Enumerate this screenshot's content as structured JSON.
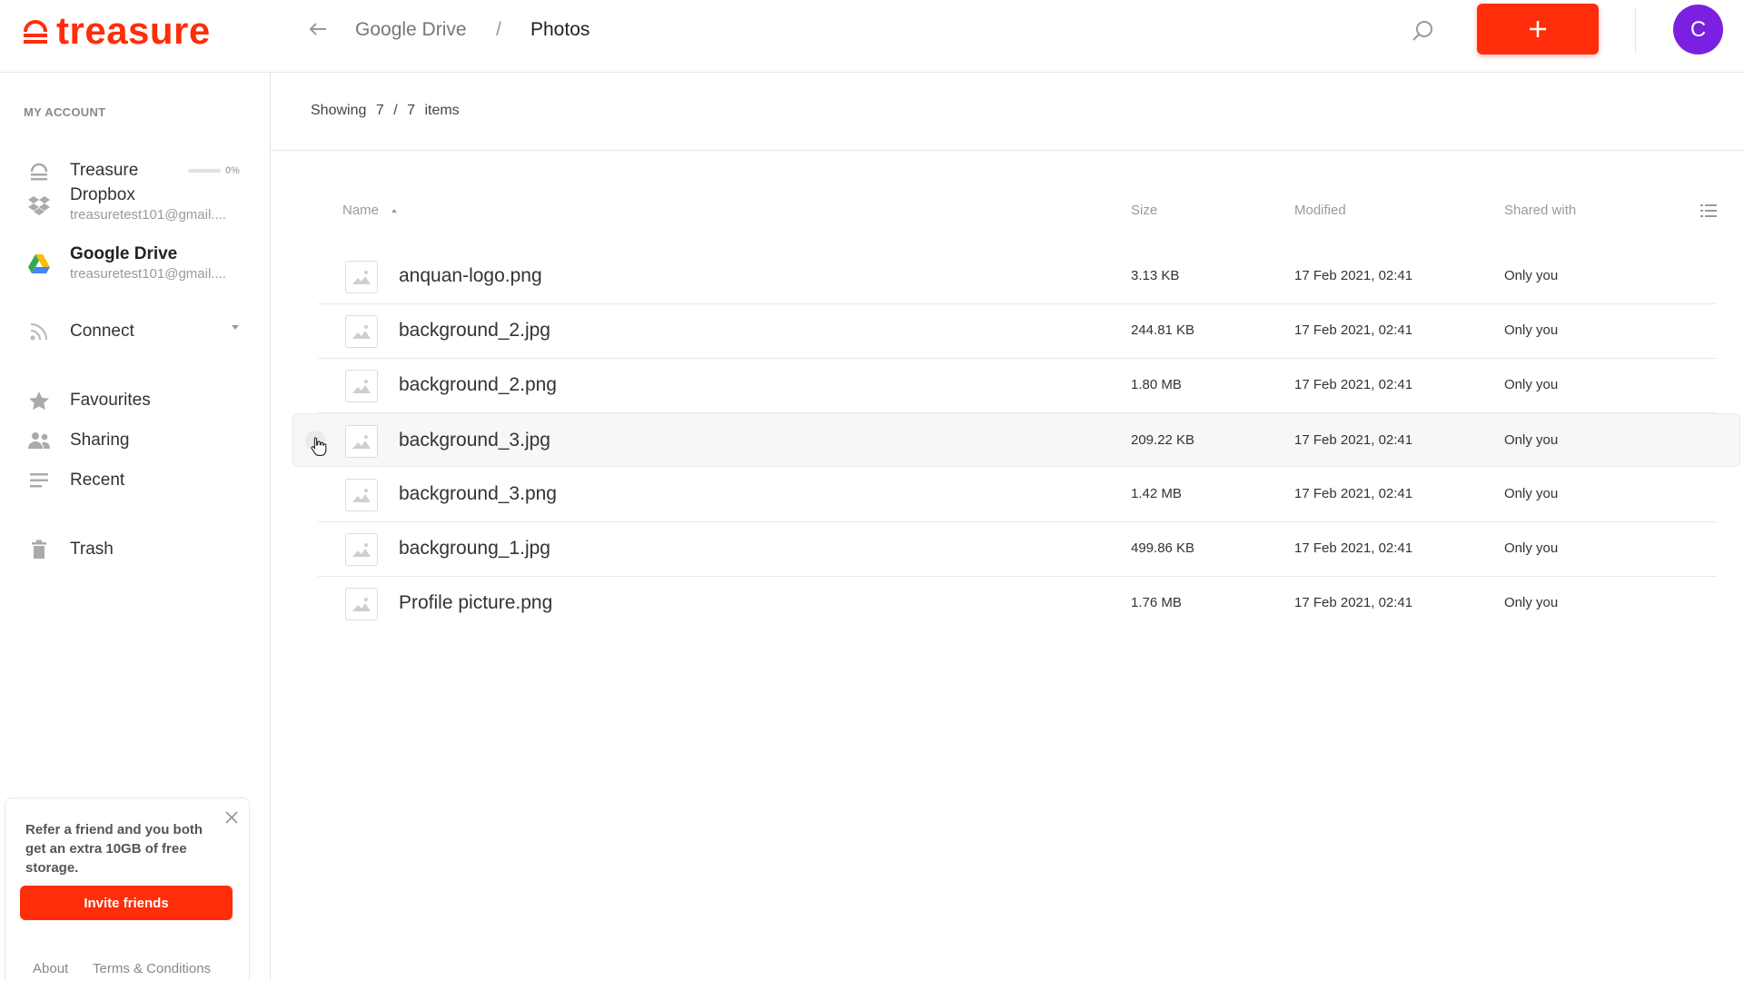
{
  "header": {
    "logo_text": "treasure",
    "breadcrumb": {
      "parent": "Google Drive",
      "separator": "/",
      "current": "Photos"
    },
    "add_label": "+",
    "avatar_initial": "C",
    "accent_color": "#ff2d0a",
    "avatar_color": "#7b1fe0"
  },
  "sidebar": {
    "section_title": "MY ACCOUNT",
    "treasure": {
      "label": "Treasure",
      "usage": "0%",
      "usage_fraction": 0
    },
    "dropbox": {
      "label": "Dropbox",
      "account": "treasuretest101@gmail...."
    },
    "gdrive": {
      "label": "Google Drive",
      "account": "treasuretest101@gmail...."
    },
    "connect": {
      "label": "Connect"
    },
    "favourites": {
      "label": "Favourites"
    },
    "sharing": {
      "label": "Sharing"
    },
    "recent": {
      "label": "Recent"
    },
    "trash": {
      "label": "Trash"
    },
    "refer": {
      "text": "Refer a friend and you both get an extra 10GB of free storage.",
      "button": "Invite friends"
    },
    "footer": {
      "about": "About",
      "terms": "Terms & Conditions"
    }
  },
  "main": {
    "showing": {
      "label": "Showing",
      "shown": "7",
      "sep": "/",
      "total": "7",
      "suffix": "items"
    },
    "columns": {
      "name": "Name",
      "size": "Size",
      "modified": "Modified",
      "shared": "Shared with"
    },
    "files": [
      {
        "name": "anquan-logo.png",
        "size": "3.13 KB",
        "modified": "17 Feb 2021, 02:41",
        "shared": "Only you"
      },
      {
        "name": "background_2.jpg",
        "size": "244.81 KB",
        "modified": "17 Feb 2021, 02:41",
        "shared": "Only you"
      },
      {
        "name": "background_2.png",
        "size": "1.80 MB",
        "modified": "17 Feb 2021, 02:41",
        "shared": "Only you"
      },
      {
        "name": "background_3.jpg",
        "size": "209.22 KB",
        "modified": "17 Feb 2021, 02:41",
        "shared": "Only you"
      },
      {
        "name": "background_3.png",
        "size": "1.42 MB",
        "modified": "17 Feb 2021, 02:41",
        "shared": "Only you"
      },
      {
        "name": "backgroung_1.jpg",
        "size": "499.86 KB",
        "modified": "17 Feb 2021, 02:41",
        "shared": "Only you"
      },
      {
        "name": "Profile picture.png",
        "size": "1.76 MB",
        "modified": "17 Feb 2021, 02:41",
        "shared": "Only you"
      }
    ]
  }
}
